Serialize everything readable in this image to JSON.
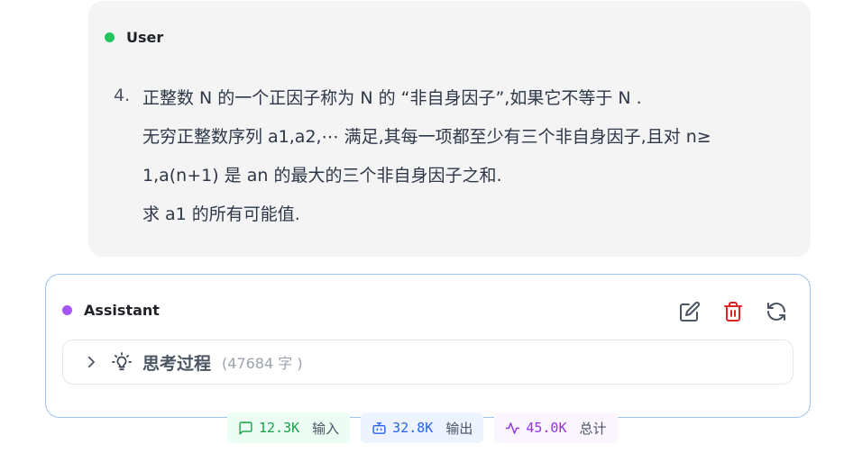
{
  "user": {
    "role": "User",
    "dot_color": "#22c55e",
    "item_number": "4.",
    "lines": [
      "正整数 N 的一个正因子称为 N 的 “非自身因子”,如果它不等于 N .",
      "无穷正整数序列 a1,a2,⋯ 满足,其每一项都至少有三个非自身因子,且对 n≥",
      "1,a(n+1) 是 an 的最大的三个非自身因子之和.",
      "求 a1 的所有可能值."
    ]
  },
  "assistant": {
    "role": "Assistant",
    "dot_color": "#a855f7",
    "actions": [
      "edit-icon",
      "delete-icon",
      "refresh-icon"
    ],
    "thinking": {
      "title": "思考过程",
      "count": "(47684 字 )"
    }
  },
  "stats": {
    "input": {
      "value": "12.3K",
      "label": "输入",
      "color": "#16a34a"
    },
    "output": {
      "value": "32.8K",
      "label": "输出",
      "color": "#2563eb"
    },
    "total": {
      "value": "45.0K",
      "label": "总计",
      "color": "#9333ea"
    }
  }
}
